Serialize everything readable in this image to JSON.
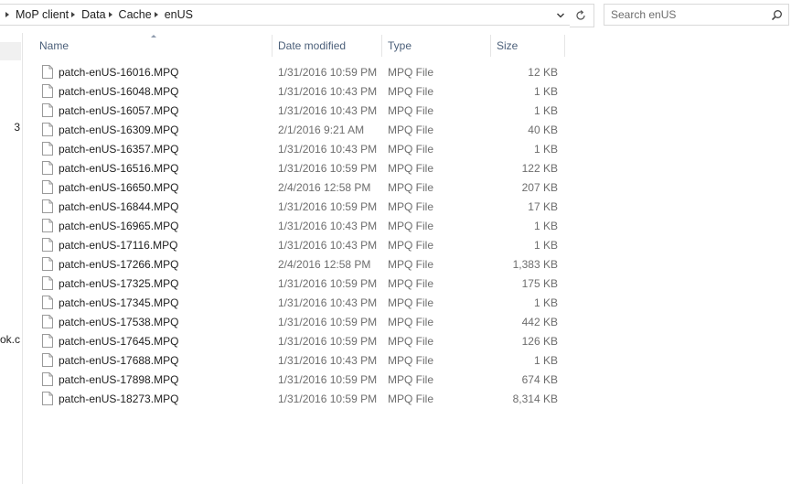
{
  "breadcrumb": [
    "MoP client",
    "Data",
    "Cache",
    "enUS"
  ],
  "search": {
    "placeholder": "Search enUS"
  },
  "nav_partial": [
    "3",
    "ook.c"
  ],
  "columns": {
    "name": "Name",
    "date": "Date modified",
    "type": "Type",
    "size": "Size"
  },
  "files": [
    {
      "name": "patch-enUS-16016.MPQ",
      "date": "1/31/2016 10:59 PM",
      "type": "MPQ File",
      "size": "12 KB"
    },
    {
      "name": "patch-enUS-16048.MPQ",
      "date": "1/31/2016 10:43 PM",
      "type": "MPQ File",
      "size": "1 KB"
    },
    {
      "name": "patch-enUS-16057.MPQ",
      "date": "1/31/2016 10:43 PM",
      "type": "MPQ File",
      "size": "1 KB"
    },
    {
      "name": "patch-enUS-16309.MPQ",
      "date": "2/1/2016 9:21 AM",
      "type": "MPQ File",
      "size": "40 KB"
    },
    {
      "name": "patch-enUS-16357.MPQ",
      "date": "1/31/2016 10:43 PM",
      "type": "MPQ File",
      "size": "1 KB"
    },
    {
      "name": "patch-enUS-16516.MPQ",
      "date": "1/31/2016 10:59 PM",
      "type": "MPQ File",
      "size": "122 KB"
    },
    {
      "name": "patch-enUS-16650.MPQ",
      "date": "2/4/2016 12:58 PM",
      "type": "MPQ File",
      "size": "207 KB"
    },
    {
      "name": "patch-enUS-16844.MPQ",
      "date": "1/31/2016 10:59 PM",
      "type": "MPQ File",
      "size": "17 KB"
    },
    {
      "name": "patch-enUS-16965.MPQ",
      "date": "1/31/2016 10:43 PM",
      "type": "MPQ File",
      "size": "1 KB"
    },
    {
      "name": "patch-enUS-17116.MPQ",
      "date": "1/31/2016 10:43 PM",
      "type": "MPQ File",
      "size": "1 KB"
    },
    {
      "name": "patch-enUS-17266.MPQ",
      "date": "2/4/2016 12:58 PM",
      "type": "MPQ File",
      "size": "1,383 KB"
    },
    {
      "name": "patch-enUS-17325.MPQ",
      "date": "1/31/2016 10:59 PM",
      "type": "MPQ File",
      "size": "175 KB"
    },
    {
      "name": "patch-enUS-17345.MPQ",
      "date": "1/31/2016 10:43 PM",
      "type": "MPQ File",
      "size": "1 KB"
    },
    {
      "name": "patch-enUS-17538.MPQ",
      "date": "1/31/2016 10:59 PM",
      "type": "MPQ File",
      "size": "442 KB"
    },
    {
      "name": "patch-enUS-17645.MPQ",
      "date": "1/31/2016 10:59 PM",
      "type": "MPQ File",
      "size": "126 KB"
    },
    {
      "name": "patch-enUS-17688.MPQ",
      "date": "1/31/2016 10:43 PM",
      "type": "MPQ File",
      "size": "1 KB"
    },
    {
      "name": "patch-enUS-17898.MPQ",
      "date": "1/31/2016 10:59 PM",
      "type": "MPQ File",
      "size": "674 KB"
    },
    {
      "name": "patch-enUS-18273.MPQ",
      "date": "1/31/2016 10:59 PM",
      "type": "MPQ File",
      "size": "8,314 KB"
    }
  ],
  "icons": {
    "dropdown": "chevron-down-icon",
    "refresh": "refresh-icon",
    "search": "search-icon",
    "file": "file-icon",
    "sort": "sort-ascending-icon"
  },
  "colors": {
    "header_text": "#4c607a",
    "secondary_text": "#6d6d6d",
    "border": "#d9d9d9"
  }
}
